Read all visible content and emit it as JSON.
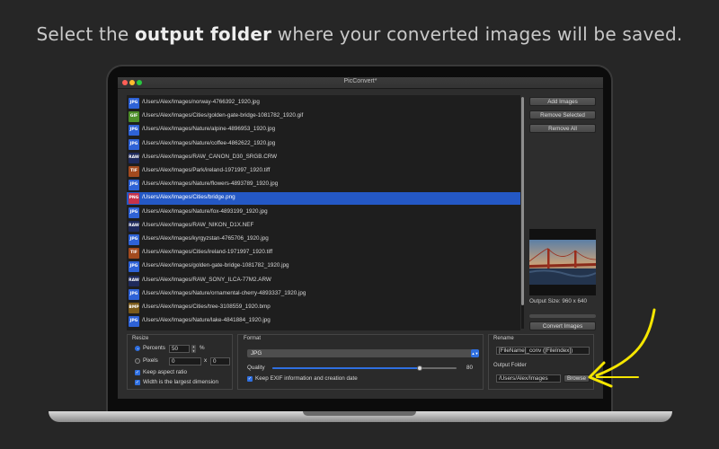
{
  "headline": {
    "pre": "Select the ",
    "bold": "output folder",
    "post": " where your converted images will be saved."
  },
  "window": {
    "title": "PicConvert*"
  },
  "files": [
    {
      "type": "JPG",
      "color": "#2e62d6",
      "path": "/Users/Alex/Images/norway-4766392_1920.jpg"
    },
    {
      "type": "GIF",
      "color": "#4e8f2a",
      "path": "/Users/Alex/Images/Cities/golden-gate-bridge-1081782_1920.gif"
    },
    {
      "type": "JPG",
      "color": "#2e62d6",
      "path": "/Users/Alex/Images/Nature/alpine-4896953_1920.jpg"
    },
    {
      "type": "JPG",
      "color": "#2e62d6",
      "path": "/Users/Alex/Images/Nature/coffee-4862622_1920.jpg"
    },
    {
      "type": "RAW",
      "color": "#1f2a5c",
      "path": "/Users/Alex/Images/RAW_CANON_D30_SRGB.CRW"
    },
    {
      "type": "TIF",
      "color": "#a24a1e",
      "path": "/Users/Alex/Images/Park/ireland-1971997_1920.tiff"
    },
    {
      "type": "JPG",
      "color": "#2e62d6",
      "path": "/Users/Alex/Images/Nature/flowers-4893789_1920.jpg"
    },
    {
      "type": "PNG",
      "color": "#c6324a",
      "path": "/Users/Alex/Images/Cities/bridge.png",
      "selected": true
    },
    {
      "type": "JPG",
      "color": "#2e62d6",
      "path": "/Users/Alex/Images/Nature/fox-4893199_1920.jpg"
    },
    {
      "type": "RAW",
      "color": "#1f2a5c",
      "path": "/Users/Alex/Images/RAW_NIKON_D1X.NEF"
    },
    {
      "type": "JPG",
      "color": "#2e62d6",
      "path": "/Users/Alex/Images/kyrgyzstan-4765706_1920.jpg"
    },
    {
      "type": "TIF",
      "color": "#a24a1e",
      "path": "/Users/Alex/Images/Cities/ireland-1971997_1920.tiff"
    },
    {
      "type": "JPG",
      "color": "#2e62d6",
      "path": "/Users/Alex/Images/golden-gate-bridge-1081782_1920.jpg"
    },
    {
      "type": "RAW",
      "color": "#1f2a5c",
      "path": "/Users/Alex/Images/RAW_SONY_ILCA-77M2.ARW"
    },
    {
      "type": "JPG",
      "color": "#2e62d6",
      "path": "/Users/Alex/Images/Nature/ornamental-cherry-4893337_1920.jpg"
    },
    {
      "type": "BMP",
      "color": "#7a5a1a",
      "path": "/Users/Alex/Images/Cities/tree-3108559_1920.bmp"
    },
    {
      "type": "JPG",
      "color": "#2e62d6",
      "path": "/Users/Alex/Images/Nature/lake-4841884_1920.jpg"
    }
  ],
  "sidebar": {
    "add_images": "Add Images",
    "remove_selected": "Remove Selected",
    "remove_all": "Remove All",
    "output_size": "Output Size: 960 x 640",
    "convert": "Convert Images"
  },
  "resize": {
    "label": "Resize",
    "percents_label": "Percents",
    "percents_value": "50",
    "percent_sign": "%",
    "pixels_label": "Pixels",
    "pixels_w": "0",
    "x_sep": "x",
    "pixels_h": "0",
    "keep_aspect": "Keep aspect ratio",
    "width_largest": "Width is the largest dimension"
  },
  "format": {
    "label": "Format",
    "selected": "JPG",
    "quality_label": "Quality",
    "quality_value": "80",
    "quality_fraction": 0.8,
    "keep_exif": "Keep EXIF information and creation date"
  },
  "rename": {
    "label": "Rename",
    "pattern": "[FileName]_conv ([FileIndex])"
  },
  "output_folder": {
    "label": "Output Folder",
    "path": "/Users/Alex/Images",
    "browse": "Browse"
  },
  "colors": {
    "selection": "#2458c5",
    "accent": "#2f6fe0",
    "arrow": "#f5e600"
  }
}
